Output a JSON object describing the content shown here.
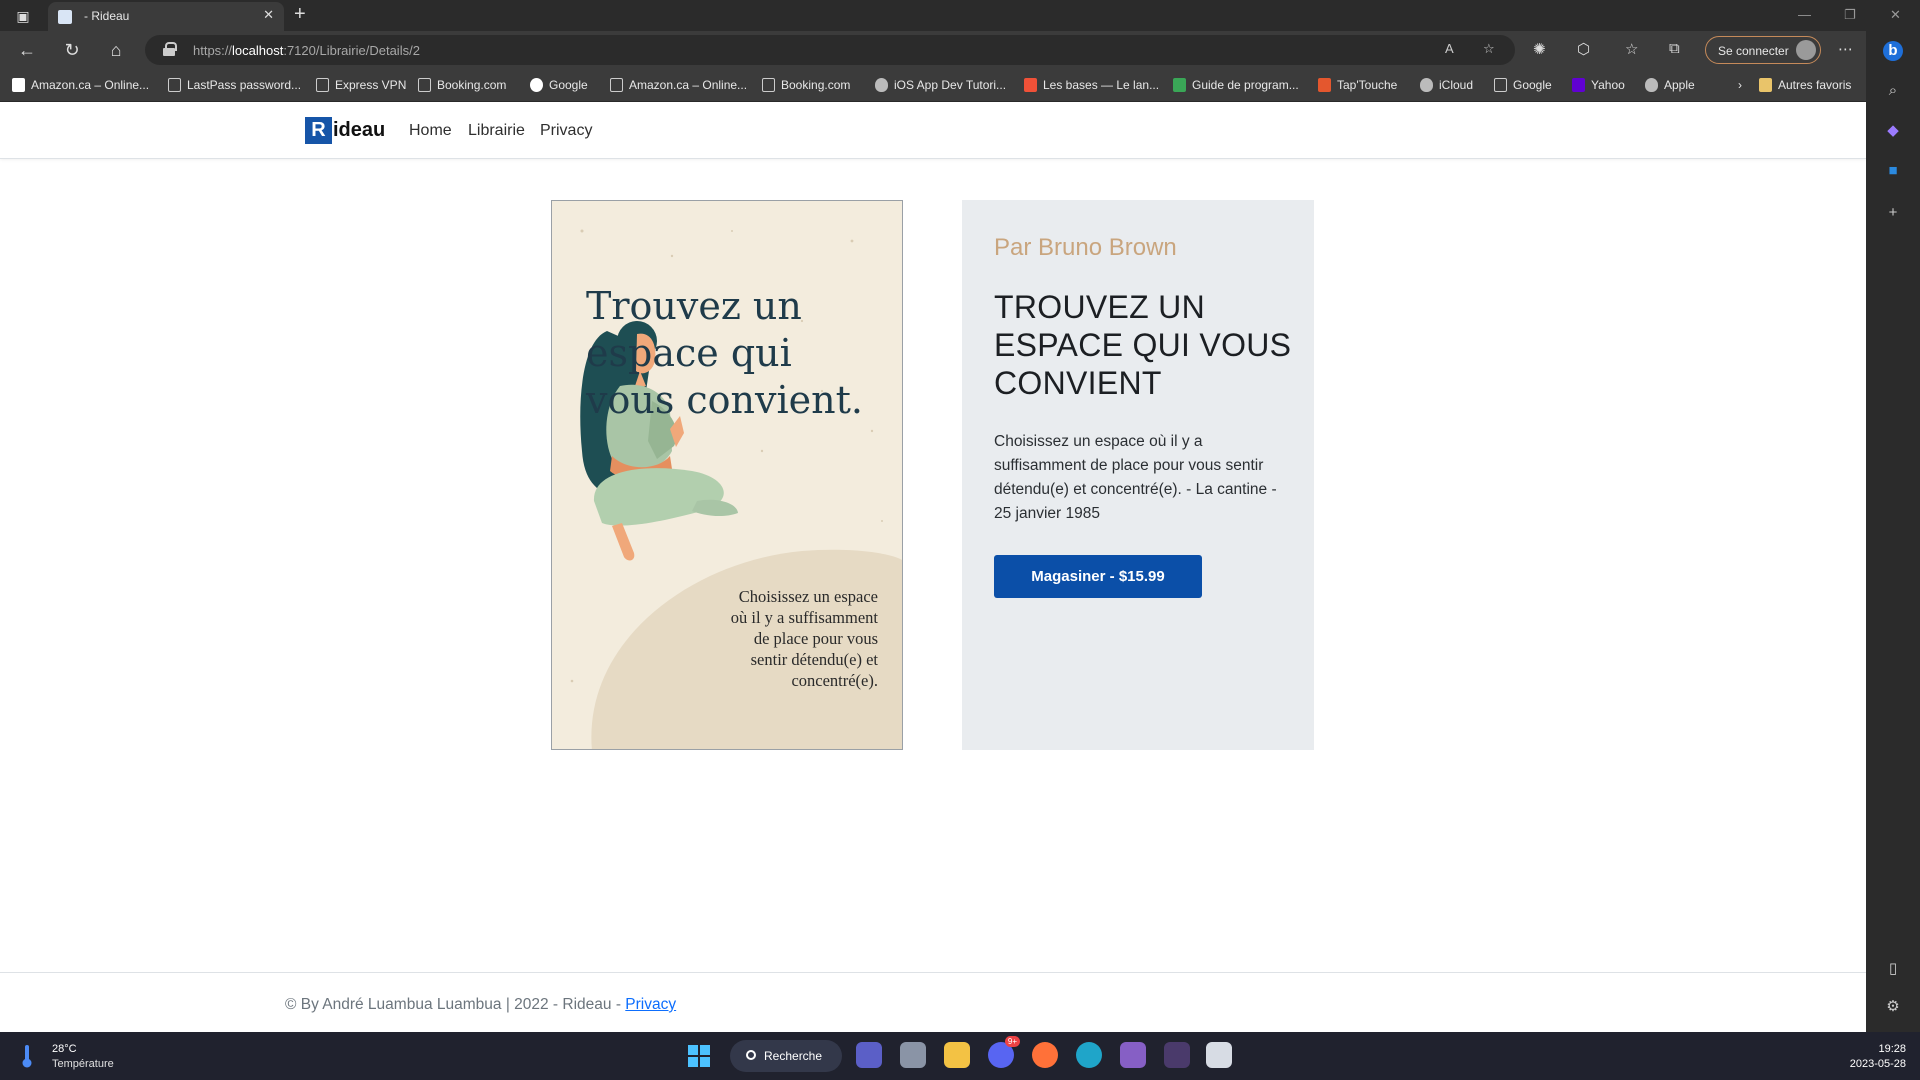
{
  "browser": {
    "tab_title": "- Rideau",
    "url_prefix": "https://",
    "url_host": "localhost",
    "url_rest": ":7120/Librairie/Details/2",
    "signin_label": "Se connecter",
    "bookmarks": [
      {
        "label": "Amazon.ca – Online...",
        "icon": "amazon-icon"
      },
      {
        "label": "LastPass password...",
        "icon": "file-icon"
      },
      {
        "label": "Express VPN",
        "icon": "file-icon"
      },
      {
        "label": "Booking.com",
        "icon": "file-icon"
      },
      {
        "label": "Google",
        "icon": "google-icon"
      },
      {
        "label": "Amazon.ca – Online...",
        "icon": "file-icon"
      },
      {
        "label": "Booking.com",
        "icon": "file-icon"
      },
      {
        "label": "iOS App Dev Tutori...",
        "icon": "apple-icon"
      },
      {
        "label": "Les bases — Le lan...",
        "icon": "swift-icon"
      },
      {
        "label": "Guide de program...",
        "icon": "guide-icon"
      },
      {
        "label": "Tap'Touche",
        "icon": "taptouche-icon"
      },
      {
        "label": "iCloud",
        "icon": "apple-icon"
      },
      {
        "label": "Google",
        "icon": "file-icon"
      },
      {
        "label": "Yahoo",
        "icon": "yahoo-icon"
      },
      {
        "label": "Apple",
        "icon": "apple-icon"
      }
    ],
    "other_favorites": "Autres favoris"
  },
  "site": {
    "brand_letter": "R",
    "brand_rest": "ideau",
    "nav": [
      "Home",
      "Librairie",
      "Privacy"
    ]
  },
  "poster": {
    "title": "Trouvez un espace qui vous convient.",
    "text": "Choisissez un espace où il y a suffisamment de place pour vous sentir détendu(e) et concentré(e)."
  },
  "book": {
    "author": "Par Bruno Brown",
    "title": "TROUVEZ UN ESPACE QUI VOUS CONVIENT",
    "description": "Choisissez un espace où il y a suffisamment de place pour vous sentir détendu(e) et concentré(e). - La cantine - 25 janvier 1985",
    "buy_label": "Magasiner - $15.99"
  },
  "footer": {
    "text": "© By André Luambua Luambua | 2022 - Rideau - ",
    "privacy_link": "Privacy"
  },
  "taskbar": {
    "temperature": "28°C",
    "weather_label": "Température",
    "search_label": "Recherche",
    "time": "19:28",
    "date": "2023-05-28",
    "discord_badge": "9+"
  },
  "colors": {
    "brand_blue": "#1655a8",
    "button_blue": "#0b4fa8",
    "author_tan": "#c9a57e",
    "card_bg": "#e9ecef",
    "poster_bg": "#f3ecdd"
  }
}
